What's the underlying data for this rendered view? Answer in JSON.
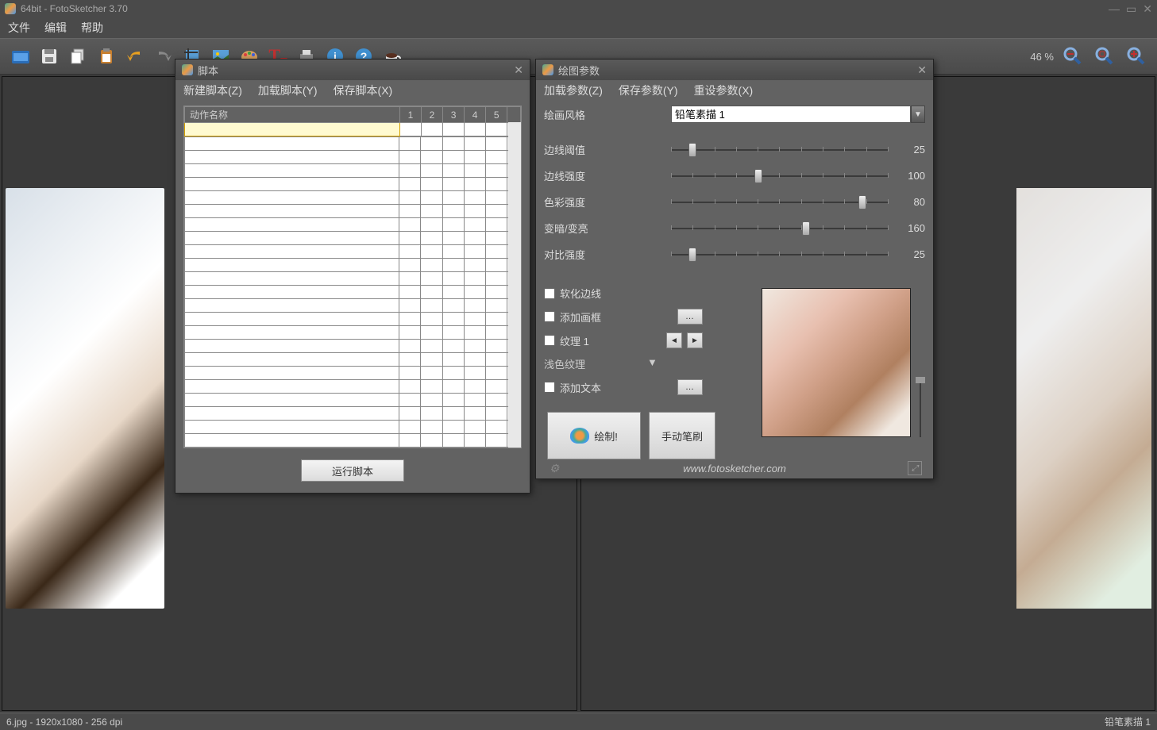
{
  "title": "64bit - FotoSketcher 3.70",
  "menu": {
    "file": "文件",
    "edit": "编辑",
    "help": "帮助"
  },
  "zoom": "46 %",
  "status": {
    "left": "6.jpg - 1920x1080 - 256 dpi",
    "right": "铅笔素描 1"
  },
  "script": {
    "title": "脚本",
    "menu": {
      "new": "新建脚本(Z)",
      "load": "加载脚本(Y)",
      "save": "保存脚本(X)"
    },
    "col_name": "动作名称",
    "cols": [
      "1",
      "2",
      "3",
      "4",
      "5"
    ],
    "run": "运行脚本"
  },
  "params": {
    "title": "绘图参数",
    "menu": {
      "load": "加载参数(Z)",
      "save": "保存参数(Y)",
      "reset": "重设参数(X)"
    },
    "style_label": "绘画风格",
    "style_value": "铅笔素描 1",
    "sliders": [
      {
        "label": "边线阈值",
        "value": "25",
        "pos": 10
      },
      {
        "label": "边线强度",
        "value": "100",
        "pos": 40
      },
      {
        "label": "色彩强度",
        "value": "80",
        "pos": 88
      },
      {
        "label": "变暗/变亮",
        "value": "160",
        "pos": 62
      },
      {
        "label": "对比强度",
        "value": "25",
        "pos": 10
      }
    ],
    "chk": {
      "soften": "软化边线",
      "frame": "添加画框",
      "texture": "纹理 1",
      "text": "添加文本"
    },
    "texture_sel": "浅色纹理",
    "btn": {
      "draw": "绘制!",
      "brush": "手动笔刷"
    },
    "url": "www.fotosketcher.com"
  }
}
